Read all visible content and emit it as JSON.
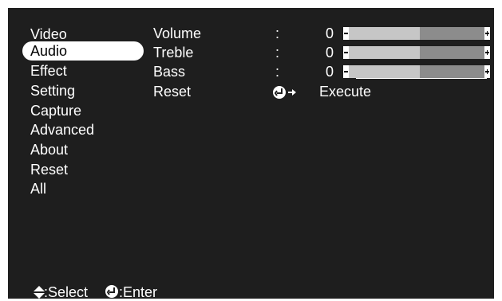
{
  "menu": {
    "items": [
      {
        "label": "Video"
      },
      {
        "label": "Audio"
      },
      {
        "label": "Effect"
      },
      {
        "label": "Setting"
      },
      {
        "label": "Capture"
      },
      {
        "label": "Advanced"
      },
      {
        "label": "About"
      },
      {
        "label": "Reset All"
      }
    ],
    "selected": "Audio"
  },
  "settings": [
    {
      "label": "Volume",
      "separator": ":",
      "value": "0",
      "level": 0.5
    },
    {
      "label": "Treble",
      "separator": ":",
      "value": "0",
      "level": 0.5
    },
    {
      "label": "Bass",
      "separator": ":",
      "value": "0",
      "level": 0.5
    },
    {
      "label": "Reset",
      "action": "Execute"
    }
  ],
  "footer": {
    "select_label": ":Select",
    "enter_label": ":Enter"
  },
  "icons": {
    "select": "up-down-arrow-icon",
    "enter": "enter-key-icon"
  },
  "colors": {
    "screen_bg": "#1e1e1e",
    "text": "#ffffff",
    "highlight_bg": "#ffffff",
    "highlight_text": "#000000",
    "slider_light": "#c6c6c6",
    "slider_dark": "#8c8c8c"
  }
}
